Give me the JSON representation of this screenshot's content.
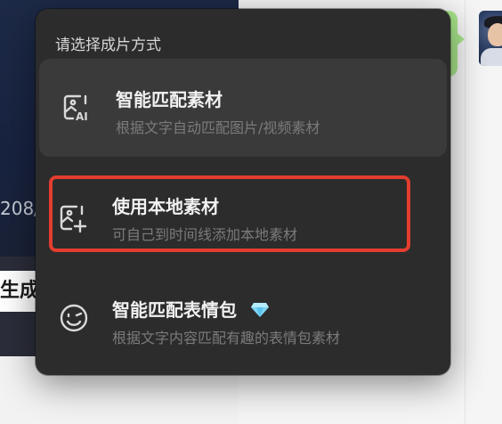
{
  "background": {
    "counter_text": "208/",
    "generate_label": "生成"
  },
  "popup": {
    "title": "请选择成片方式",
    "items": [
      {
        "title": "智能匹配素材",
        "desc": "根据文字自动匹配图片/视频素材",
        "icon": "image-ai-icon"
      },
      {
        "title": "使用本地素材",
        "desc": "可自己到时间线添加本地素材",
        "icon": "image-add-icon"
      },
      {
        "title": "智能匹配表情包",
        "desc": "根据文字内容匹配有趣的表情包素材",
        "icon": "smiley-icon",
        "badge_icon": "diamond-icon"
      }
    ]
  },
  "colors": {
    "popup_bg": "#2c2c2c",
    "hover_bg": "#3a3a3a",
    "highlight": "#e23d2f",
    "chat_bubble": "#a8e58a"
  }
}
